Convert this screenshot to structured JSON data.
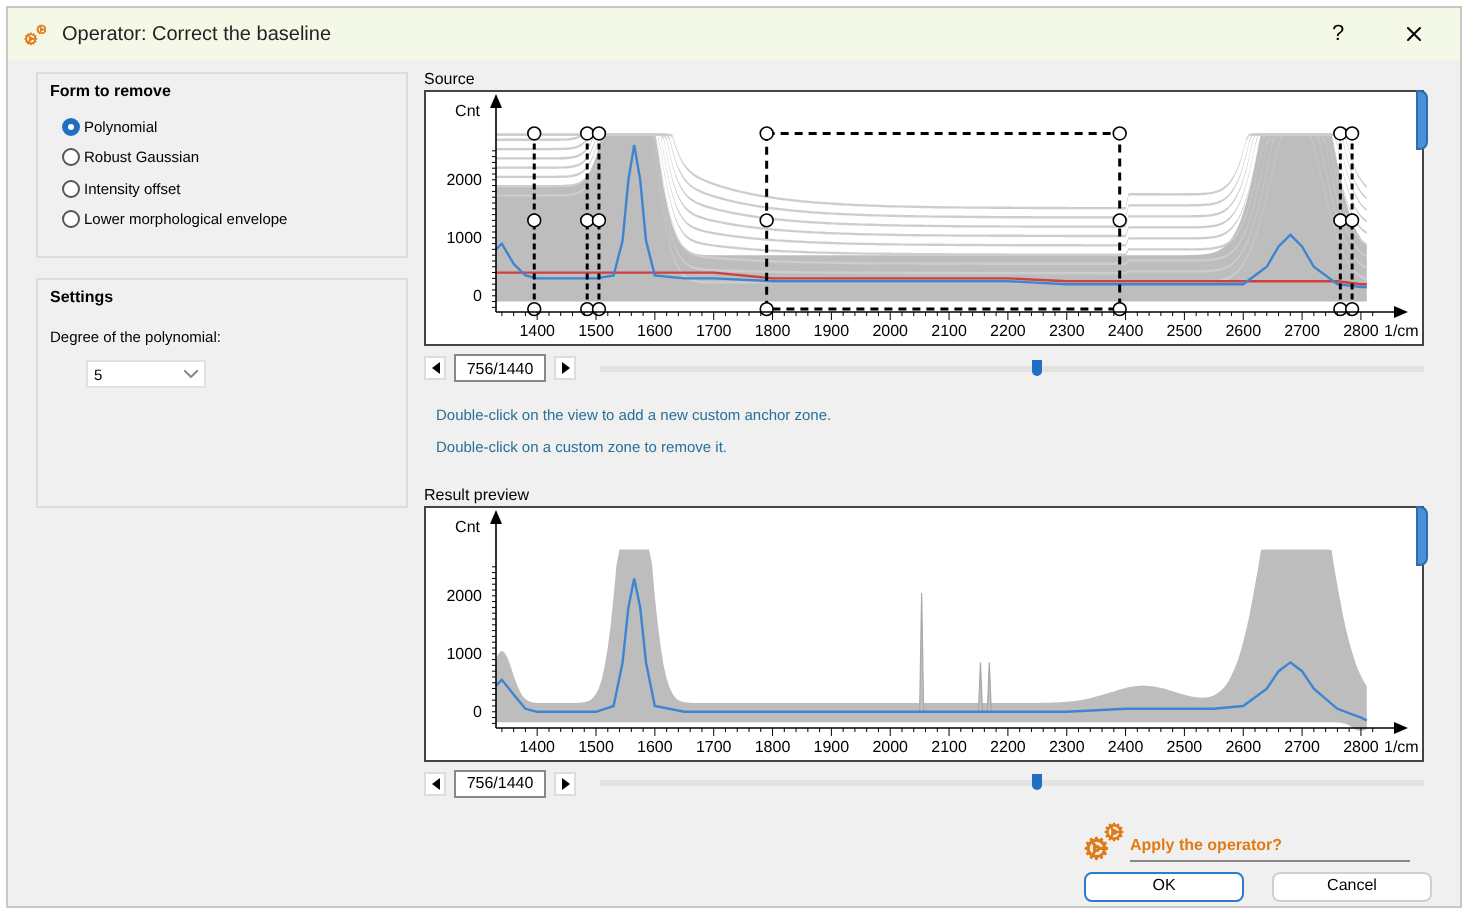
{
  "window": {
    "title": "Operator: Correct the baseline",
    "help": "?"
  },
  "form_to_remove": {
    "title": "Form to remove",
    "options": [
      {
        "label": "Polynomial",
        "selected": true
      },
      {
        "label": "Robust Gaussian",
        "selected": false
      },
      {
        "label": "Intensity offset",
        "selected": false
      },
      {
        "label": "Lower morphological envelope",
        "selected": false
      }
    ]
  },
  "settings": {
    "title": "Settings",
    "degree_label": "Degree of the polynomial:",
    "degree_value": "5"
  },
  "source": {
    "title": "Source",
    "chart_data": {
      "type": "line",
      "ylabel": "Cnt",
      "xlabel": "1/cm",
      "xlim": [
        1330,
        2880
      ],
      "ylim": [
        -280,
        3480
      ],
      "yticks": [
        0,
        1000,
        2000
      ],
      "xticks": [
        1400,
        1500,
        1600,
        1700,
        1800,
        1900,
        2000,
        2100,
        2200,
        2300,
        2400,
        2500,
        2600,
        2700,
        2800
      ],
      "x": [
        1330,
        1340,
        1360,
        1380,
        1400,
        1450,
        1500,
        1530,
        1545,
        1555,
        1565,
        1575,
        1585,
        1600,
        1650,
        1700,
        1800,
        1900,
        2000,
        2100,
        2200,
        2300,
        2400,
        2500,
        2550,
        2600,
        2640,
        2660,
        2680,
        2700,
        2720,
        2760,
        2800,
        2810
      ],
      "series": [
        {
          "color": "#3d85d0",
          "values": [
            800,
            900,
            550,
            350,
            300,
            300,
            300,
            350,
            950,
            2000,
            2600,
            2000,
            950,
            350,
            300,
            300,
            250,
            250,
            250,
            250,
            250,
            200,
            200,
            200,
            200,
            200,
            500,
            850,
            1050,
            850,
            500,
            200,
            150,
            150
          ]
        },
        {
          "color": "#d04040",
          "values": [
            400,
            400,
            400,
            400,
            400,
            400,
            400,
            400,
            400,
            400,
            400,
            400,
            400,
            400,
            400,
            400,
            300,
            300,
            300,
            300,
            300,
            250,
            250,
            250,
            250,
            250,
            250,
            250,
            250,
            250,
            250,
            250,
            200,
            200
          ]
        }
      ]
    },
    "pager": {
      "value": "756/1440",
      "level": 0.53
    },
    "hints": [
      "Double-click on the view to add a new custom anchor zone.",
      "Double-click on a custom zone to remove it."
    ]
  },
  "result_preview": {
    "title": "Result preview",
    "chart_data": {
      "type": "line",
      "ylabel": "Cnt",
      "xlabel": "1/cm",
      "xlim": [
        1330,
        2880
      ],
      "ylim": [
        -280,
        3480
      ],
      "yticks": [
        0,
        1000,
        2000
      ],
      "xticks": [
        1400,
        1500,
        1600,
        1700,
        1800,
        1900,
        2000,
        2100,
        2200,
        2300,
        2400,
        2500,
        2600,
        2700,
        2800
      ],
      "x": [
        1330,
        1340,
        1360,
        1380,
        1400,
        1450,
        1500,
        1530,
        1545,
        1555,
        1565,
        1575,
        1585,
        1600,
        1650,
        1700,
        1800,
        1900,
        2000,
        2100,
        2200,
        2300,
        2400,
        2500,
        2550,
        2600,
        2640,
        2660,
        2680,
        2700,
        2720,
        2760,
        2800,
        2810
      ],
      "series": [
        {
          "color": "#3d85d0",
          "values": [
            450,
            550,
            300,
            50,
            0,
            0,
            0,
            100,
            850,
            1800,
            2300,
            1800,
            850,
            100,
            0,
            0,
            0,
            0,
            0,
            0,
            0,
            0,
            50,
            50,
            50,
            100,
            400,
            700,
            850,
            700,
            400,
            50,
            -100,
            -150
          ]
        }
      ]
    },
    "pager": {
      "value": "756/1440",
      "level": 0.53
    }
  },
  "apply": {
    "label": "Apply the operator?"
  },
  "buttons": [
    {
      "label": "OK",
      "kind": "default"
    },
    {
      "label": "Cancel",
      "kind": "normal"
    }
  ]
}
